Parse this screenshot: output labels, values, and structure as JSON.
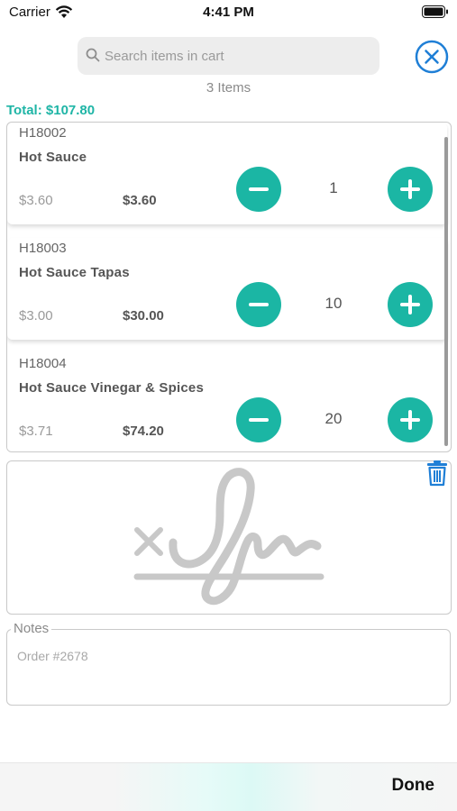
{
  "status_bar": {
    "carrier": "Carrier",
    "time": "4:41 PM"
  },
  "search": {
    "placeholder": "Search items in cart",
    "value": ""
  },
  "summary": {
    "items_count": "3 Items",
    "total": "Total: $107.80"
  },
  "cart": {
    "items": [
      {
        "sku": "H18002",
        "name": "Hot Sauce",
        "unit_price": "$3.60",
        "line_total": "$3.60",
        "quantity": "1"
      },
      {
        "sku": "H18003",
        "name": "Hot Sauce Tapas",
        "unit_price": "$3.00",
        "line_total": "$30.00",
        "quantity": "10"
      },
      {
        "sku": "H18004",
        "name": "Hot Sauce Vinegar & Spices",
        "unit_price": "$3.71",
        "line_total": "$74.20",
        "quantity": "20"
      }
    ]
  },
  "notes": {
    "label": "Notes",
    "value": "Order #2678"
  },
  "footer": {
    "done_label": "Done"
  },
  "colors": {
    "accent": "#1bb6a4",
    "total_text": "#1fb5a6",
    "icon_blue": "#1f7fd6"
  },
  "icons": {
    "close": "close-circle-icon",
    "trash": "trash-icon",
    "decrement": "minus-icon",
    "increment": "plus-icon",
    "search": "search-icon"
  }
}
